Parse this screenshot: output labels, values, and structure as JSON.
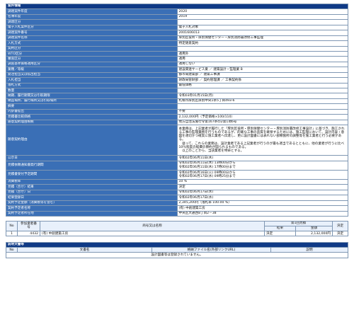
{
  "section1": {
    "title": "案件情報",
    "rows": [
      {
        "label": "調達案件年度",
        "value": "2020"
      },
      {
        "label": "名簿年度",
        "value": "2019"
      },
      {
        "label": "調達区分",
        "value": ""
      },
      {
        "label": "電子入札案件区分",
        "value": "電子入札対象"
      },
      {
        "label": "調達案件番号",
        "value": "2001606013"
      },
      {
        "label": "調達案件名称",
        "value": "厚別区役所・厚別保健センター・厚別消防署改修工事監理"
      },
      {
        "label": "入札方式",
        "value": "特定随意契約"
      },
      {
        "label": "契約区分",
        "value": ""
      },
      {
        "label": "WTO区分",
        "value": "適用外"
      },
      {
        "label": "審査区分",
        "value": "適用"
      },
      {
        "label": "調査基準価格適用区分",
        "value": "適用しない"
      },
      {
        "label": "業種／等級",
        "value": "建設関連サービス業 ／ 建築設計・監理業 B"
      },
      {
        "label": "発注担当又は払出担当",
        "value": "都市局建築部 ／ 建築工事課"
      },
      {
        "label": "入札担当",
        "value": "財政局管財部 ／ 契約管理課 ／ 工事契約係"
      },
      {
        "label": "落札方式",
        "value": "最低価格"
      },
      {
        "label": "数量",
        "value": ""
      },
      {
        "label": "納期、履行期間又は引取期限",
        "value": "令和03年01月15日(月)"
      },
      {
        "label": "納品場所、履行場所又は引取場所",
        "value": "札幌市厚別区厚別中央1条5丁目493-6"
      },
      {
        "label": "摘要",
        "value": ""
      },
      {
        "label": "内訳書提出",
        "value": "不要"
      },
      {
        "label": "見積書比較価格",
        "value": "2,132,000円（予定価格×100/110）"
      },
      {
        "label": "随意契約理由根拠",
        "value": "地方自治法施行令第167条の2第1項6号"
      }
    ],
    "reason": {
      "label": "随意契約理由",
      "lines": [
        "本業務は、上記業者が履行した「厚別区役所・厚別保健センター・厚別消防署改修工事設計」に基づき、施工される工事の監理業務を行うものであるが、的確な工事の品質を確保するためには、施工監理において、設計内容・意図を適切かつ確実に施工業者へ伝達し、更に設計図書には表れない部類箇所の調整等を施工業者と行う必要がある。",
        "　従って、これらの業務は、設計業者である上記業者が行うのが最も適当であるとともに、他の業者が行うに比べ10％程度の経費の節約が図られるものである。",
        "　以上のことから、当該業者を特命とする。"
      ]
    },
    "rows2": [
      {
        "label": "公示日",
        "value": "令和02年06月11日(木)"
      },
      {
        "label": "見積依頼通知書発行期間",
        "value": "令和02年06月11日(木) 13時00分から ／ 令和02年06月11日(木) 17時00分まで",
        "two": true
      },
      {
        "label": "見積書受付予定期間",
        "value": "令和02年06月16日(火) 09時00分から ／ 令和02年06月17日(水) 09時25分まで",
        "two": true
      },
      {
        "label": "消費税率",
        "value": "10 %"
      },
      {
        "label": "見積（合せ）結果",
        "value": "決定"
      },
      {
        "label": "見積（合せ）日",
        "value": "令和02年06月17日(水)"
      },
      {
        "label": "結果登録日",
        "value": "令和02年06月17日(水)"
      },
      {
        "label": "契約予定金額（消費税等を含む）",
        "value": "2,345,200円（落札率 100.00 %）"
      },
      {
        "label": "契約予定者名称",
        "value": "(有) 中創建築工房"
      },
      {
        "label": "契約予定者所在地",
        "value": "中央区大通西8丁目2－38"
      }
    ]
  },
  "bid_table": {
    "headers": {
      "no": "No",
      "number": "参加業者番号",
      "name": "商号又は名称",
      "first": "第1回見積",
      "result": "結果",
      "amount": "金額",
      "decision": "決定"
    },
    "rows": [
      {
        "no": "1",
        "number": "4432",
        "name": "(有) 中創建築工房",
        "result": "決定",
        "amount": "2,132,000円",
        "decision": "決定"
      }
    ]
  },
  "docs": {
    "title": "説明文書等",
    "headers": {
      "no": "No",
      "doc": "文書名",
      "file": "格納ファイル名(外部リンクURL)",
      "desc": "説明"
    },
    "empty_note": "設計図書等は登録されていません。"
  }
}
